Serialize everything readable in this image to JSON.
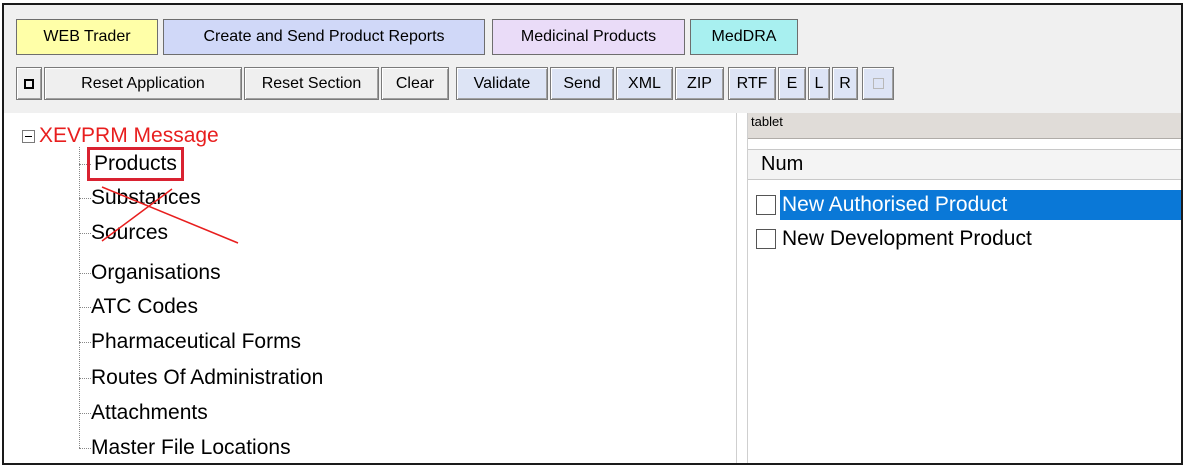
{
  "tabs": [
    {
      "label": "WEB Trader",
      "color": "#ffffa8"
    },
    {
      "label": "Create and Send Product Reports",
      "color": "#d0d8f8"
    },
    {
      "label": "Medicinal Products",
      "color": "#eadcf8"
    },
    {
      "label": "MedDRA",
      "color": "#a8f0f0"
    }
  ],
  "buttons": [
    {
      "label": "Reset Application"
    },
    {
      "label": "Reset Section"
    },
    {
      "label": "Clear"
    },
    {
      "label": "Validate"
    },
    {
      "label": "Send"
    },
    {
      "label": "XML"
    },
    {
      "label": "ZIP"
    },
    {
      "label": "RTF"
    },
    {
      "label": "E"
    },
    {
      "label": "L"
    },
    {
      "label": "R"
    }
  ],
  "tree": {
    "root": "XEVPRM Message",
    "root_color": "#e81e1e",
    "children": [
      {
        "label": "Products",
        "selected": true
      },
      {
        "label": "Substances",
        "crossed_out": true
      },
      {
        "label": "Sources",
        "crossed_out": true
      },
      {
        "label": "Organisations"
      },
      {
        "label": "ATC Codes"
      },
      {
        "label": "Pharmaceutical Forms"
      },
      {
        "label": "Routes Of Administration"
      },
      {
        "label": "Attachments"
      },
      {
        "label": "Master File Locations"
      }
    ]
  },
  "right_panel": {
    "filter_value": "tablet",
    "column_header": "Num",
    "rows": [
      {
        "label": "New Authorised Product",
        "selected": true
      },
      {
        "label": "New Development Product",
        "selected": false
      }
    ],
    "selection_color": "#0a78d7"
  }
}
